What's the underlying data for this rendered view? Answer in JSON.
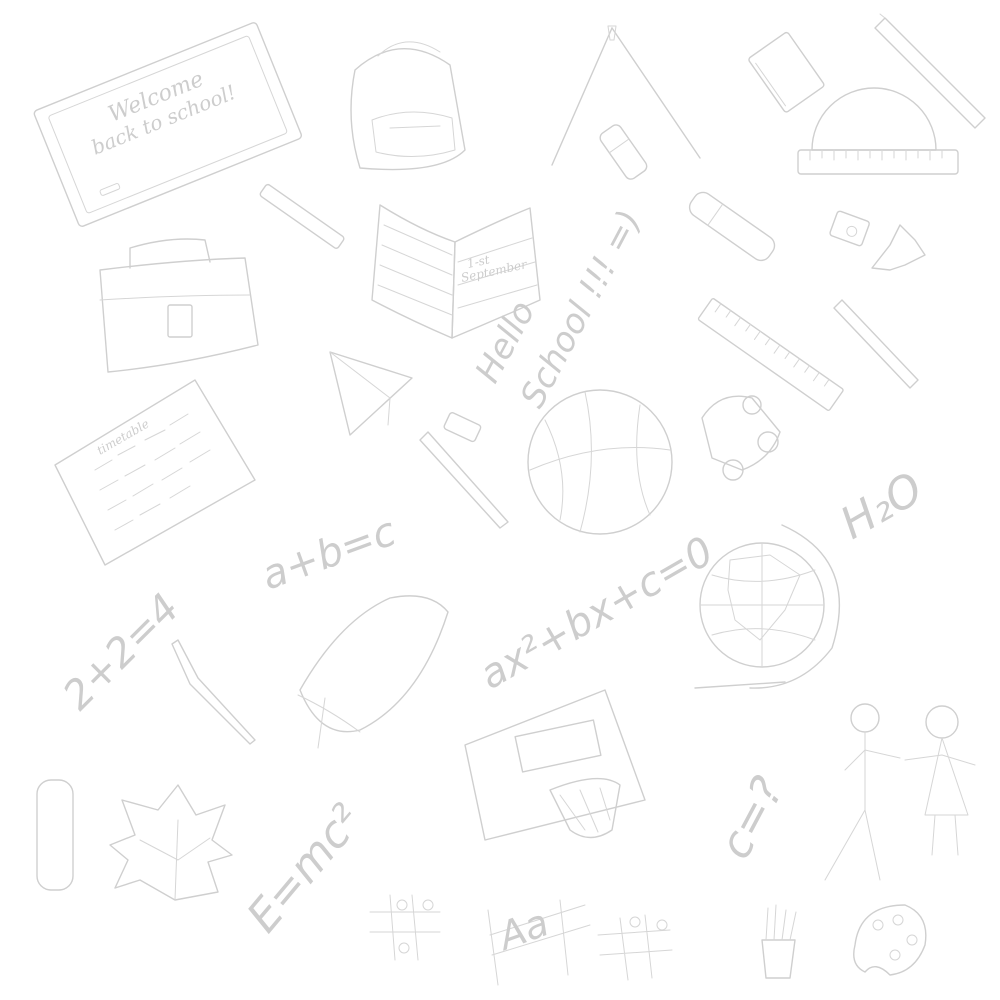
{
  "palette": {
    "background": "#ffffff",
    "ink": "#cfcfcf"
  },
  "texts": {
    "welcome": "Welcome",
    "back_to_school": "back to school!",
    "first_september_line1": "1-st",
    "first_september_line2": "September",
    "timetable": "timetable",
    "hello": "Hello",
    "school": "School !!! =)",
    "water": "H₂O",
    "eq_abc": "a+b=c",
    "eq_2x2": "2+2=4",
    "eq_quadratic": "ax²+bx+c=0",
    "eq_einstein": "E=mc²",
    "eq_c": "c=?",
    "letters": "Aa"
  }
}
